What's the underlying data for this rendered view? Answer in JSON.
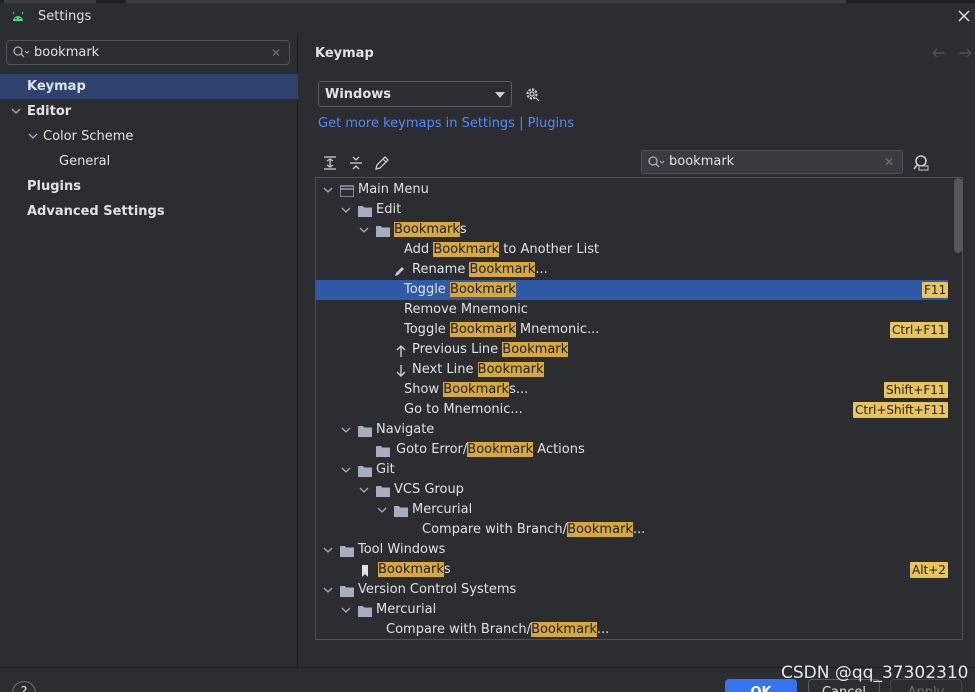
{
  "window": {
    "title": "Settings"
  },
  "left": {
    "search_value": "bookmark",
    "items": [
      {
        "label": "Keymap"
      },
      {
        "label": "Editor"
      },
      {
        "label": "Color Scheme"
      },
      {
        "label": "General"
      },
      {
        "label": "Plugins"
      },
      {
        "label": "Advanced Settings"
      }
    ]
  },
  "right": {
    "breadcrumb": "Keymap",
    "keymap_select": "Windows",
    "get_more_link": "Get more keymaps in Settings | Plugins",
    "tree_search_value": "bookmark"
  },
  "tree": {
    "rows": [
      {
        "pre": "Main Menu",
        "hl": "",
        "post": "",
        "shortcut": ""
      },
      {
        "pre": "Edit",
        "hl": "",
        "post": "",
        "shortcut": ""
      },
      {
        "pre": "",
        "hl": "Bookmark",
        "post": "s",
        "shortcut": ""
      },
      {
        "pre": "Add ",
        "hl": "Bookmark",
        "post": " to Another List",
        "shortcut": ""
      },
      {
        "pre": "Rename ",
        "hl": "Bookmark",
        "post": "...",
        "shortcut": ""
      },
      {
        "pre": "Toggle ",
        "hl": "Bookmark",
        "post": "",
        "shortcut": "F11"
      },
      {
        "pre": "Remove Mnemonic",
        "hl": "",
        "post": "",
        "shortcut": ""
      },
      {
        "pre": "Toggle ",
        "hl": "Bookmark",
        "post": " Mnemonic...",
        "shortcut": "Ctrl+F11"
      },
      {
        "pre": "Previous Line ",
        "hl": "Bookmark",
        "post": "",
        "shortcut": ""
      },
      {
        "pre": "Next Line ",
        "hl": "Bookmark",
        "post": "",
        "shortcut": ""
      },
      {
        "pre": "Show ",
        "hl": "Bookmark",
        "post": "s...",
        "shortcut": "Shift+F11"
      },
      {
        "pre": "Go to Mnemonic...",
        "hl": "",
        "post": "",
        "shortcut": "Ctrl+Shift+F11"
      },
      {
        "pre": "Navigate",
        "hl": "",
        "post": "",
        "shortcut": ""
      },
      {
        "pre": "Goto Error/",
        "hl": "Bookmark",
        "post": " Actions",
        "shortcut": ""
      },
      {
        "pre": "Git",
        "hl": "",
        "post": "",
        "shortcut": ""
      },
      {
        "pre": "VCS Group",
        "hl": "",
        "post": "",
        "shortcut": ""
      },
      {
        "pre": "Mercurial",
        "hl": "",
        "post": "",
        "shortcut": ""
      },
      {
        "pre": "Compare with Branch/",
        "hl": "Bookmark",
        "post": "...",
        "shortcut": ""
      },
      {
        "pre": "Tool Windows",
        "hl": "",
        "post": "",
        "shortcut": ""
      },
      {
        "pre": "",
        "hl": "Bookmark",
        "post": "s",
        "shortcut": "Alt+2"
      },
      {
        "pre": "Version Control Systems",
        "hl": "",
        "post": "",
        "shortcut": ""
      },
      {
        "pre": "Mercurial",
        "hl": "",
        "post": "",
        "shortcut": ""
      },
      {
        "pre": "Compare with Branch/",
        "hl": "Bookmark",
        "post": "...",
        "shortcut": ""
      }
    ]
  },
  "footer": {
    "help": "?",
    "ok": "OK",
    "cancel": "Cancel",
    "apply": "Apply"
  },
  "watermark": "CSDN @qq_37302310",
  "colors": {
    "accent": "#3574f0",
    "selection": "#2e5aa8",
    "highlight": "#d6a93a"
  }
}
